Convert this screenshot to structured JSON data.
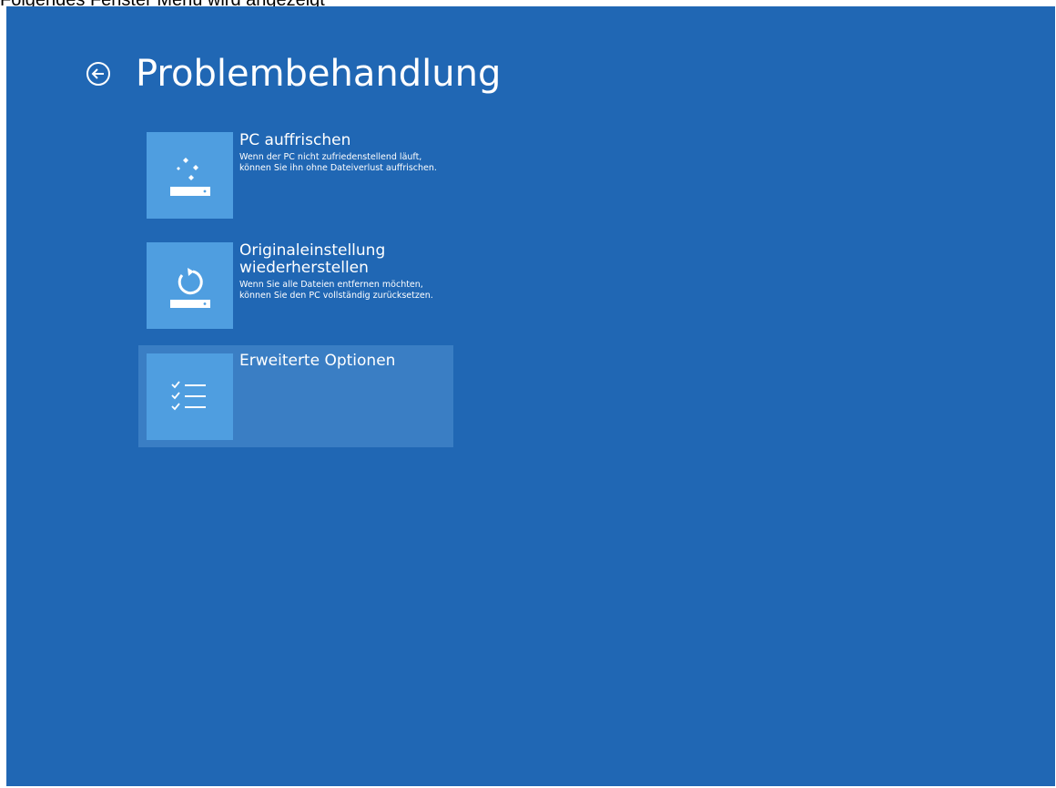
{
  "caption": "Folgendes Fenster Menü wird angezeigt",
  "colors": {
    "background": "#2067b4",
    "tile": "#4f9ee0",
    "selected_row": "#3a7ec4",
    "text": "#ffffff"
  },
  "header": {
    "back_icon": "back-arrow-circle-icon",
    "title": "Problembehandlung"
  },
  "options": [
    {
      "title": "PC auffrischen",
      "description": "Wenn der PC nicht zufriedenstellend läuft, können Sie ihn ohne Dateiverlust auffrischen.",
      "icon": "refresh-pc-sparkle-icon",
      "selected": false
    },
    {
      "title": "Originaleinstellung wiederherstellen",
      "description": "Wenn Sie alle Dateien entfernen möchten, können Sie den PC vollständig zurücksetzen.",
      "icon": "reset-pc-circular-arrow-icon",
      "selected": false
    },
    {
      "title": "Erweiterte Optionen",
      "description": "",
      "icon": "checklist-icon",
      "selected": true
    }
  ]
}
